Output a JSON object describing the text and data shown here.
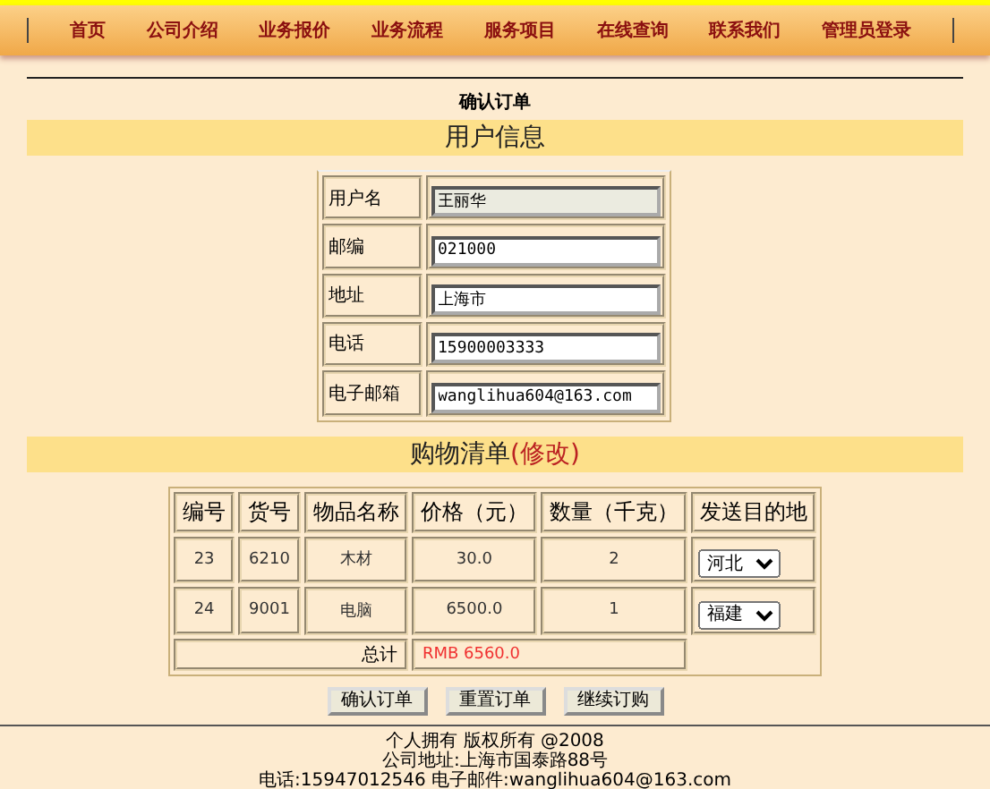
{
  "nav": {
    "items": [
      {
        "label": "首页"
      },
      {
        "label": "公司介绍"
      },
      {
        "label": "业务报价"
      },
      {
        "label": "业务流程"
      },
      {
        "label": "服务项目"
      },
      {
        "label": "在线查询"
      },
      {
        "label": "联系我们"
      },
      {
        "label": "管理员登录"
      }
    ]
  },
  "page_title": "确认订单",
  "user_section": {
    "title": "用户信息",
    "fields": [
      {
        "label": "用户名",
        "value": "王丽华",
        "disabled": true
      },
      {
        "label": "邮编",
        "value": "021000",
        "disabled": false
      },
      {
        "label": "地址",
        "value": "上海市",
        "disabled": false
      },
      {
        "label": "电话",
        "value": "15900003333",
        "disabled": false
      },
      {
        "label": "电子邮箱",
        "value": "wanglihua604@163.com",
        "disabled": false
      }
    ]
  },
  "cart_section": {
    "title": "购物清单",
    "edit_link": "(修改)",
    "table": {
      "columns": [
        "编号",
        "货号",
        "物品名称",
        "价格（元）",
        "数量（千克）",
        "发送目的地"
      ],
      "rows": [
        {
          "cells": [
            "23",
            "6210",
            "木材",
            "30.0",
            "2"
          ],
          "destination": "河北"
        },
        {
          "cells": [
            "24",
            "9001",
            "电脑",
            "6500.0",
            "1"
          ],
          "destination": "福建"
        }
      ],
      "total_label": "总计",
      "total_value": "RMB 6560.0"
    }
  },
  "buttons": [
    "确认订单",
    "重置订单",
    "继续订购"
  ],
  "footer": [
    "个人拥有 版权所有 @2008",
    "公司地址:上海市国泰路88号",
    "电话:15947012546 电子邮件:wanglihua604@163.com"
  ]
}
